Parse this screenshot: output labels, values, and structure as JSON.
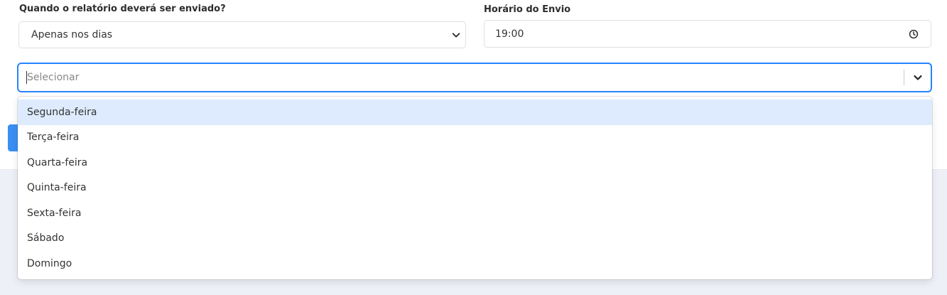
{
  "form": {
    "when_label": "Quando o relatório deverá ser enviado?",
    "when_value": "Apenas nos dias",
    "time_label": "Horário do Envio",
    "time_value": "19:00",
    "days_placeholder": "Selecionar"
  },
  "dropdown": {
    "options": [
      "Segunda-feira",
      "Terça-feira",
      "Quarta-feira",
      "Quinta-feira",
      "Sexta-feira",
      "Sábado",
      "Domingo"
    ],
    "focused_index": 0
  },
  "colors": {
    "focus_border": "#2684ff",
    "option_focus_bg": "#deebff",
    "primary_button": "#3b8ff3"
  },
  "icons": {
    "select_chevron": "chevron-down-icon",
    "time": "clock-icon",
    "multiselect_chevron": "chevron-down-icon"
  }
}
